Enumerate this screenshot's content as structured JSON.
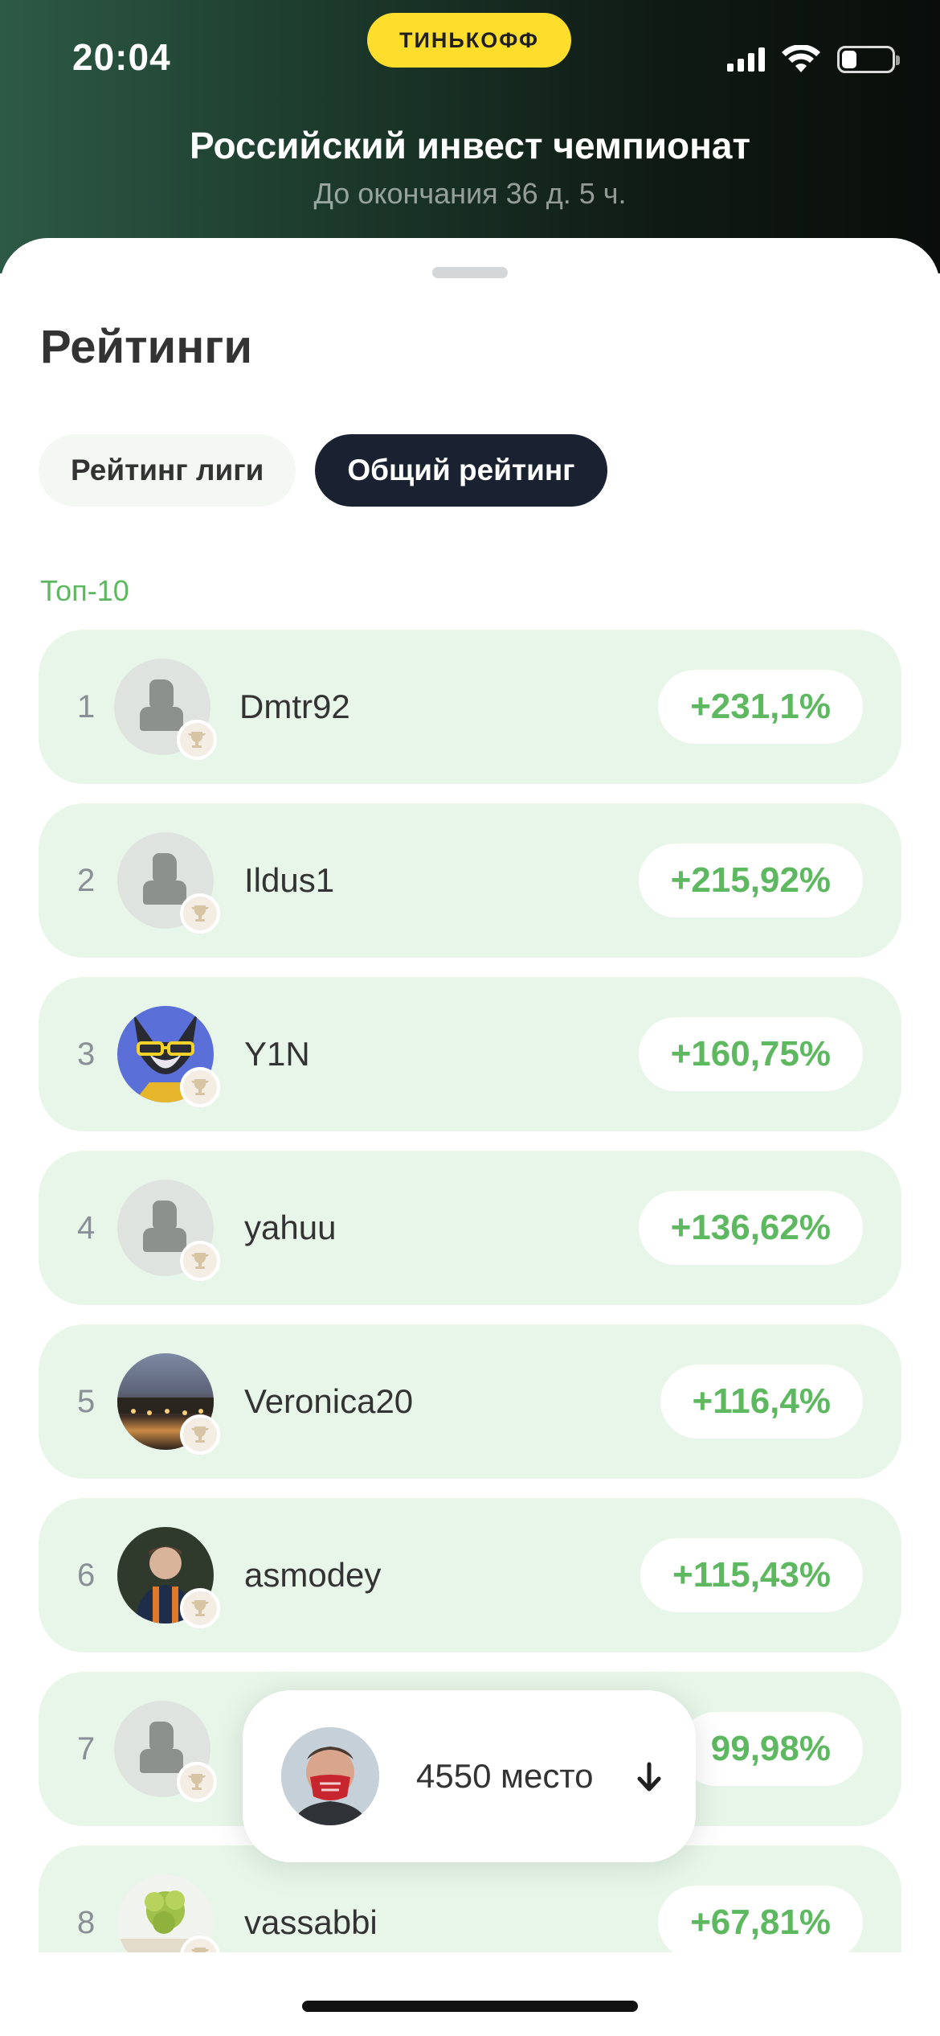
{
  "status_bar": {
    "time": "20:04",
    "brand": "ТИНЬКОФФ"
  },
  "header": {
    "title": "Российский инвест чемпионат",
    "subtitle": "До окончания 36 д. 5 ч."
  },
  "ratings": {
    "title": "Рейтинги",
    "tabs": [
      {
        "label": "Рейтинг лиги",
        "active": false
      },
      {
        "label": "Общий рейтинг",
        "active": true
      }
    ],
    "section_label": "Топ-10",
    "rows": [
      {
        "rank": "1",
        "name": "Dmtr92",
        "score": "+231,1%",
        "avatar": "default"
      },
      {
        "rank": "2",
        "name": "Ildus1",
        "score": "+215,92%",
        "avatar": "default"
      },
      {
        "rank": "3",
        "name": "Y1N",
        "score": "+160,75%",
        "avatar": "cartoon-cat"
      },
      {
        "rank": "4",
        "name": "yahuu",
        "score": "+136,62%",
        "avatar": "default"
      },
      {
        "rank": "5",
        "name": "Veronica20",
        "score": "+116,4%",
        "avatar": "city-night-photo"
      },
      {
        "rank": "6",
        "name": "asmodey",
        "score": "+115,43%",
        "avatar": "man-photo"
      },
      {
        "rank": "7",
        "name": "",
        "score": "99,98%",
        "avatar": "default"
      },
      {
        "rank": "8",
        "name": "vassabbi",
        "score": "+67,81%",
        "avatar": "green-plant-photo"
      }
    ]
  },
  "my_place": {
    "label": "4550 место",
    "arrow": "arrow-down-icon"
  },
  "colors": {
    "accent_green": "#5db860",
    "row_bg": "#e8f6e9",
    "active_tab": "#1a2231",
    "brand_yellow": "#ffdd2d"
  }
}
